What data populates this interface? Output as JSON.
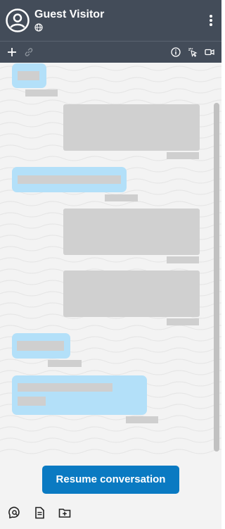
{
  "header": {
    "title": "Guest Visitor",
    "avatar_icon": "user-avatar-icon",
    "subtitle_icon": "globe-icon",
    "menu_icon": "kebab-menu-icon",
    "background_color": "#434c59"
  },
  "toolbar": {
    "icons": [
      "add-icon",
      "link-icon",
      "info-icon",
      "cursor-click-icon",
      "video-icon"
    ]
  },
  "chat": {
    "incoming_bubble_color": "#b3e0f9",
    "outgoing_bubble_color": "#d0d0d0"
  },
  "footer": {
    "resume_label": "Resume conversation",
    "resume_color": "#0a7ac2",
    "icons": [
      "search-chat-icon",
      "document-icon",
      "add-folder-icon"
    ]
  }
}
